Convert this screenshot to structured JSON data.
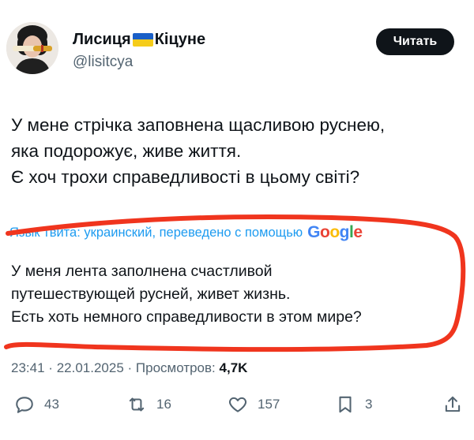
{
  "author": {
    "display_name": "Лисиця",
    "display_name_suffix": "Кіцуне",
    "flag": "flag-ukraine-icon",
    "handle": "@lisitcya"
  },
  "read_button": "Читать",
  "tweet": {
    "lines": [
      "У мене стрічка заповнена щасливою руснею,",
      "яка подорожує, живе життя.",
      "Є хоч трохи справедливості в цьому світі?"
    ]
  },
  "translation": {
    "note": "Язык твита: украинский, переведено с помощью",
    "provider": "Google",
    "lines": [
      "У меня лента заполнена счастливой",
      "путешествующей русней, живет жизнь.",
      "Есть хоть немного справедливости в этом мире?"
    ]
  },
  "meta": {
    "time": "23:41",
    "date": "22.01.2025",
    "views_label": "Просмотров:",
    "views": "4,7K"
  },
  "actions": {
    "replies": "43",
    "reposts": "16",
    "likes": "157",
    "bookmarks": "3"
  },
  "colors": {
    "accent": "#1d9bf0",
    "text": "#0f1419",
    "muted": "#536471",
    "annotation": "#f0351e"
  }
}
